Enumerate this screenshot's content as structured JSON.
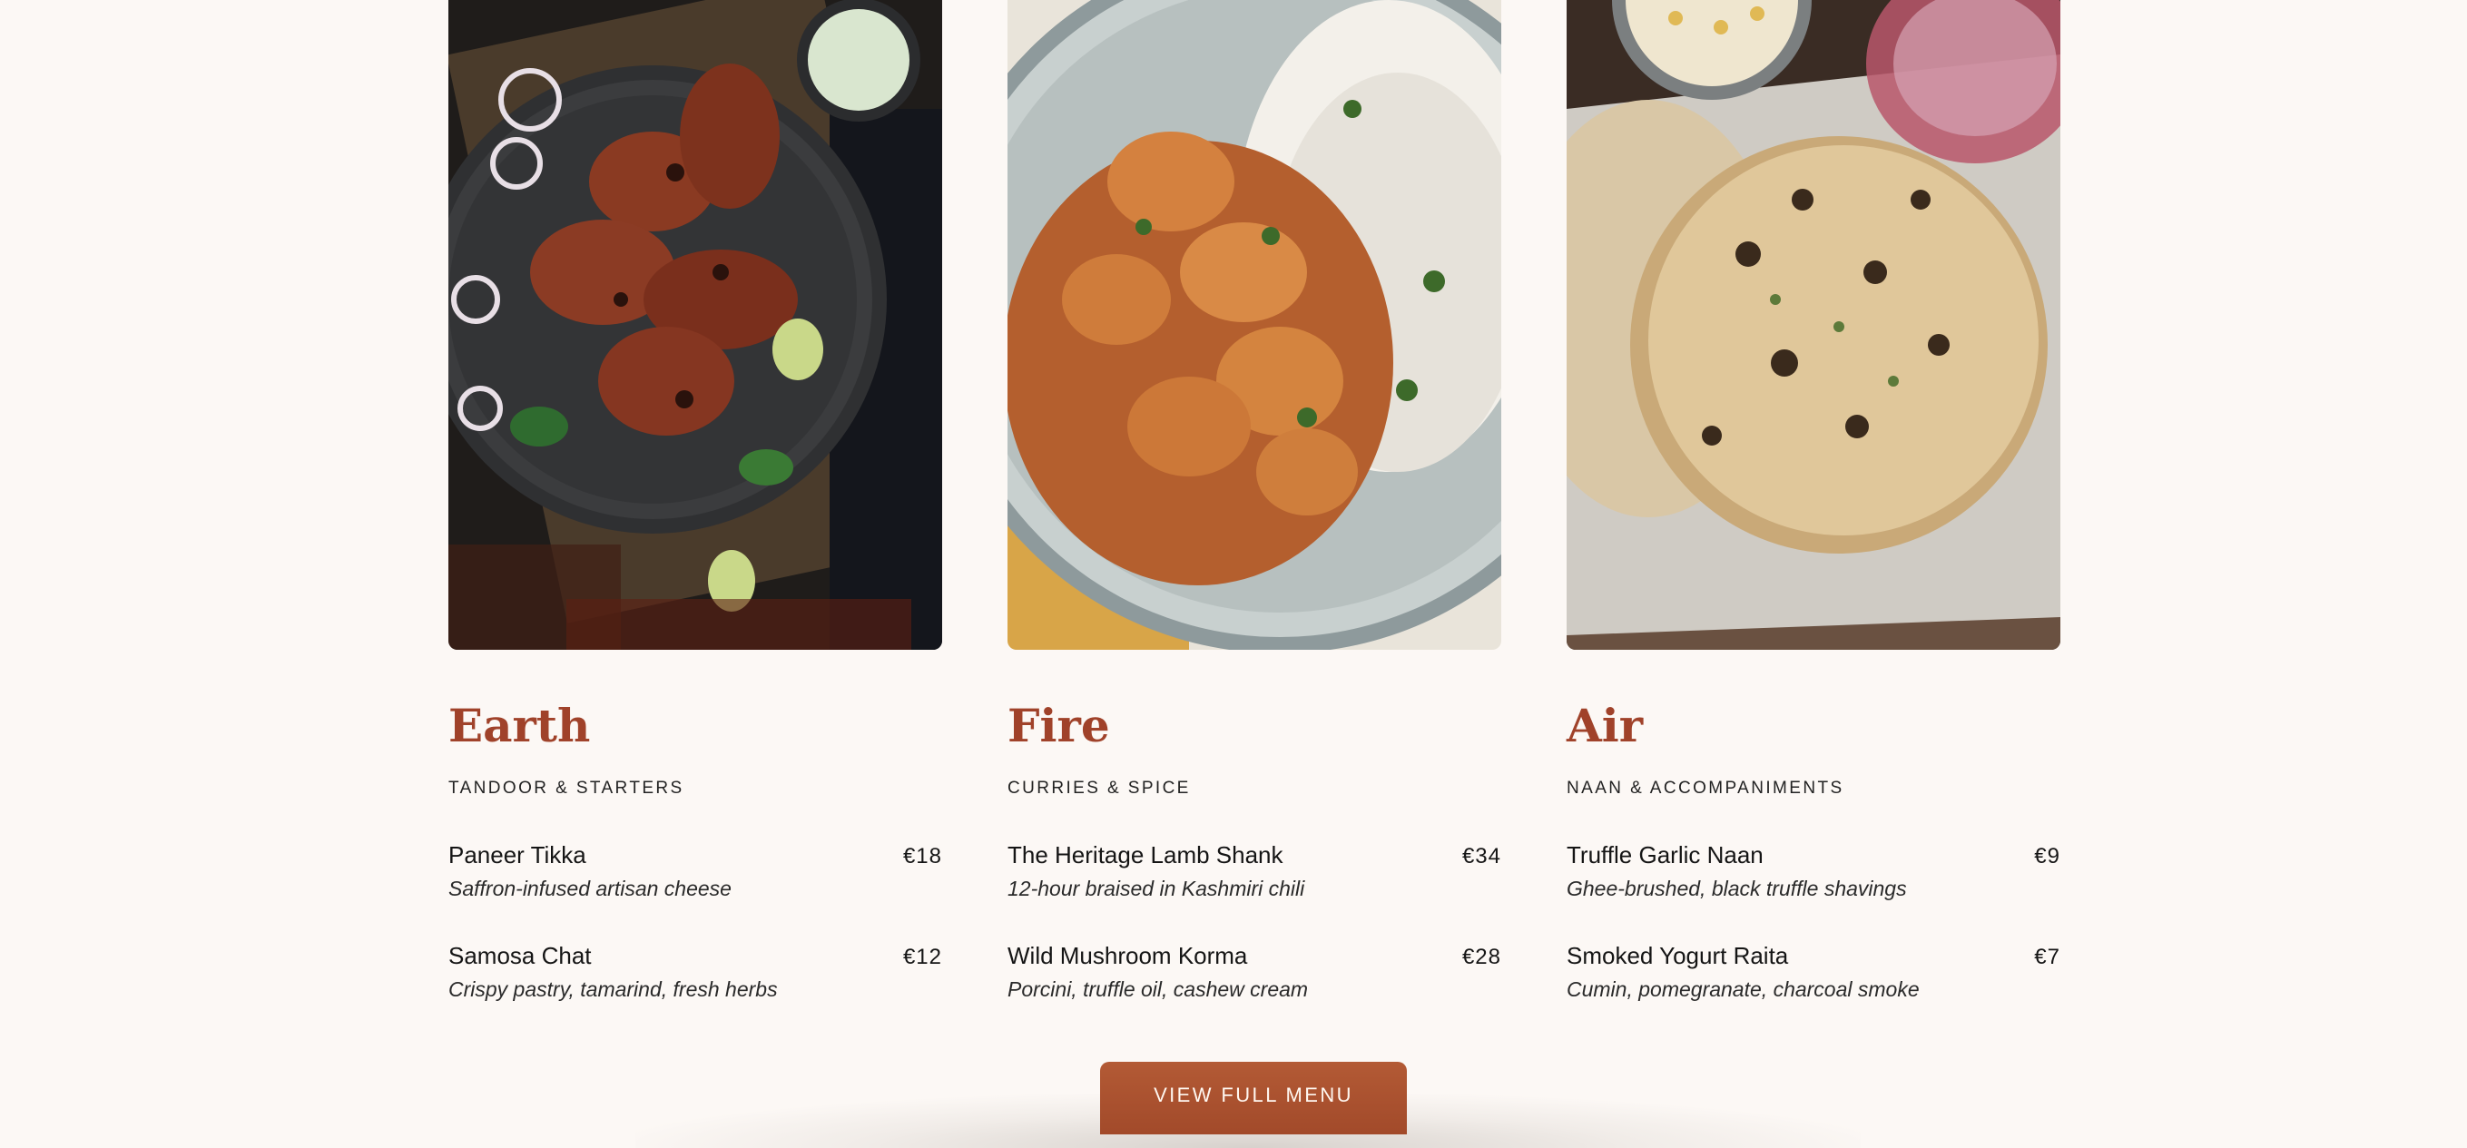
{
  "colors": {
    "background": "#fcf8f5",
    "accent": "#a0422a",
    "button": "#ab512f",
    "button_text": "#fff7f0"
  },
  "categories": [
    {
      "title": "Earth",
      "subtitle": "TANDOOR & STARTERS",
      "image": "tandoori-chicken-photo",
      "items": [
        {
          "name": "Paneer Tikka",
          "price": "€18",
          "desc": "Saffron-infused artisan cheese"
        },
        {
          "name": "Samosa Chat",
          "price": "€12",
          "desc": "Crispy pastry, tamarind, fresh herbs"
        }
      ]
    },
    {
      "title": "Fire",
      "subtitle": "CURRIES & SPICE",
      "image": "curry-and-rice-photo",
      "items": [
        {
          "name": "The Heritage Lamb Shank",
          "price": "€34",
          "desc": "12-hour braised in Kashmiri chili"
        },
        {
          "name": "Wild Mushroom Korma",
          "price": "€28",
          "desc": "Porcini, truffle oil, cashew cream"
        }
      ]
    },
    {
      "title": "Air",
      "subtitle": "NAAN & ACCOMPANIMENTS",
      "image": "garlic-naan-photo",
      "items": [
        {
          "name": "Truffle Garlic Naan",
          "price": "€9",
          "desc": "Ghee-brushed, black truffle shavings"
        },
        {
          "name": "Smoked Yogurt Raita",
          "price": "€7",
          "desc": "Cumin, pomegranate, charcoal smoke"
        }
      ]
    }
  ],
  "cta": {
    "label": "VIEW FULL MENU"
  }
}
